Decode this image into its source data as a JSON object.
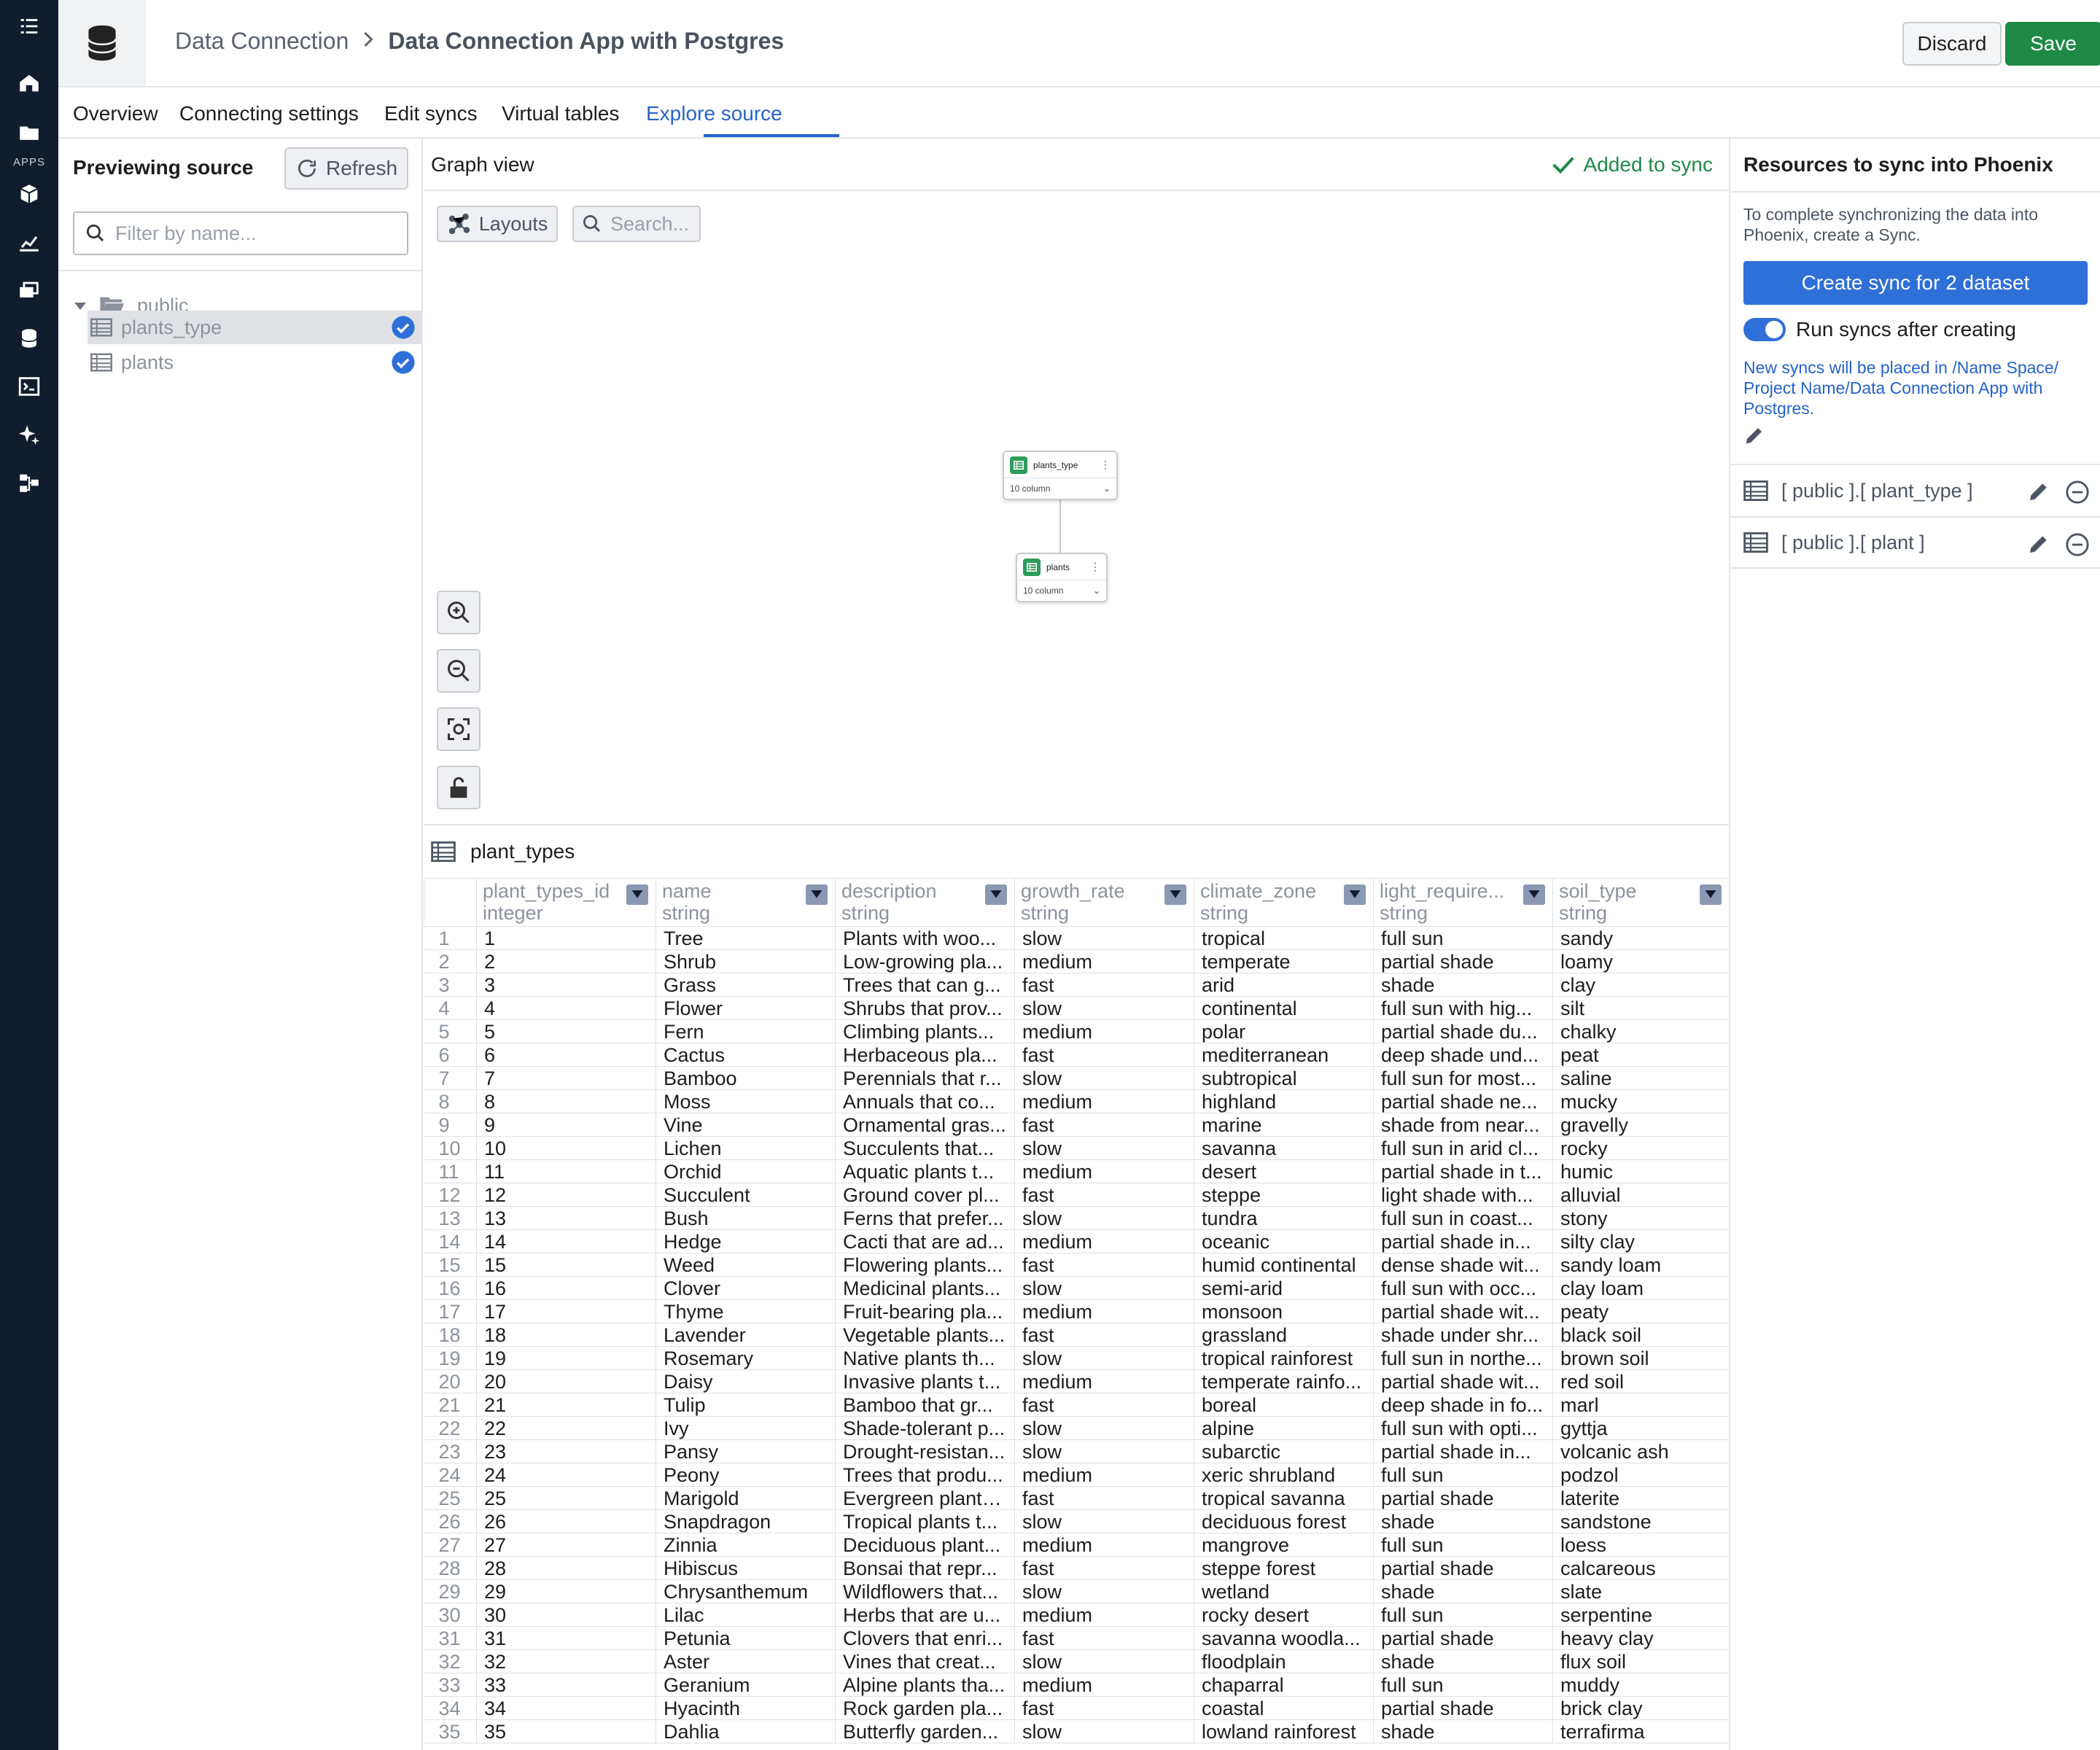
{
  "sidebar": {
    "apps_label": "APPS",
    "icons": [
      "menu-icon",
      "home-icon",
      "folder-icon",
      "cube-icon",
      "chart-icon",
      "layers-icon",
      "database-icon",
      "terminal-icon",
      "sparkle-icon",
      "flow-icon"
    ]
  },
  "header": {
    "breadcrumb_parent": "Data Connection",
    "breadcrumb_current": "Data Connection App with Postgres",
    "discard_label": "Discard",
    "save_label": "Save"
  },
  "tabs": [
    {
      "label": "Overview",
      "active": false
    },
    {
      "label": "Connecting settings",
      "active": false
    },
    {
      "label": "Edit syncs",
      "active": false
    },
    {
      "label": "Virtual tables",
      "active": false
    },
    {
      "label": "Explore source",
      "active": true
    }
  ],
  "left_panel": {
    "title": "Previewing source",
    "refresh_label": "Refresh",
    "filter_placeholder": "Filter by name...",
    "folder": "public",
    "tables": [
      {
        "name": "plants_type",
        "selected": true,
        "checked": true
      },
      {
        "name": "plants",
        "selected": false,
        "checked": true
      }
    ]
  },
  "graph": {
    "title": "Graph view",
    "status": "Added to sync",
    "layouts_label": "Layouts",
    "search_placeholder": "Search...",
    "nodes": [
      {
        "name": "plants_type",
        "columns": "10 column"
      },
      {
        "name": "plants",
        "columns": "10 column"
      }
    ]
  },
  "right_panel": {
    "title": "Resources to sync into  Phoenix",
    "description": "To complete synchronizing the data into Phoenix, create a Sync.",
    "create_label": "Create sync for 2 dataset",
    "toggle_label": "Run syncs after creating",
    "toggle_on": true,
    "note": "New syncs will be placed in /Name Space/ Project Name/Data Connection App with Postgres.",
    "resources": [
      "[ public ].[ plant_type ]",
      "[ public ].[ plant ]"
    ]
  },
  "table": {
    "title": "plant_types",
    "columns": [
      {
        "name": "plant_types_id",
        "type": "integer"
      },
      {
        "name": "name",
        "type": "string"
      },
      {
        "name": "description",
        "type": "string"
      },
      {
        "name": "growth_rate",
        "type": "string"
      },
      {
        "name": "climate_zone",
        "type": "string"
      },
      {
        "name": "light_require...",
        "type": "string"
      },
      {
        "name": "soil_type",
        "type": "string"
      }
    ],
    "rows": [
      [
        "1",
        "1",
        "Tree",
        "Plants with woo...",
        "slow",
        "tropical",
        "full sun",
        "sandy"
      ],
      [
        "2",
        "2",
        "Shrub",
        "Low-growing pla...",
        "medium",
        "temperate",
        "partial shade",
        "loamy"
      ],
      [
        "3",
        "3",
        "Grass",
        "Trees that can g...",
        "fast",
        "arid",
        "shade",
        "clay"
      ],
      [
        "4",
        "4",
        "Flower",
        "Shrubs that prov...",
        "slow",
        "continental",
        "full sun with hig...",
        "silt"
      ],
      [
        "5",
        "5",
        "Fern",
        "Climbing plants...",
        "medium",
        "polar",
        "partial shade du...",
        "chalky"
      ],
      [
        "6",
        "6",
        "Cactus",
        "Herbaceous pla...",
        "fast",
        "mediterranean",
        "deep shade und...",
        "peat"
      ],
      [
        "7",
        "7",
        "Bamboo",
        "Perennials that r...",
        "slow",
        "subtropical",
        "full sun for most...",
        "saline"
      ],
      [
        "8",
        "8",
        "Moss",
        "Annuals that co...",
        "medium",
        "highland",
        "partial shade ne...",
        "mucky"
      ],
      [
        "9",
        "9",
        "Vine",
        "Ornamental gras...",
        "fast",
        "marine",
        "shade from near...",
        "gravelly"
      ],
      [
        "10",
        "10",
        "Lichen",
        "Succulents that...",
        "slow",
        "savanna",
        "full sun in arid cl...",
        "rocky"
      ],
      [
        "11",
        "11",
        "Orchid",
        "Aquatic plants t...",
        "medium",
        "desert",
        "partial shade in t...",
        "humic"
      ],
      [
        "12",
        "12",
        "Succulent",
        "Ground cover pl...",
        "fast",
        "steppe",
        "light shade with...",
        "alluvial"
      ],
      [
        "13",
        "13",
        "Bush",
        "Ferns that prefer...",
        "slow",
        "tundra",
        "full sun in coast...",
        "stony"
      ],
      [
        "14",
        "14",
        "Hedge",
        "Cacti that are ad...",
        "medium",
        "oceanic",
        "partial shade in...",
        "silty clay"
      ],
      [
        "15",
        "15",
        "Weed",
        "Flowering plants...",
        "fast",
        "humid continental",
        "dense shade wit...",
        "sandy loam"
      ],
      [
        "16",
        "16",
        "Clover",
        "Medicinal plants...",
        "slow",
        "semi-arid",
        "full sun with occ...",
        "clay loam"
      ],
      [
        "17",
        "17",
        "Thyme",
        "Fruit-bearing pla...",
        "medium",
        "monsoon",
        "partial shade wit...",
        "peaty"
      ],
      [
        "18",
        "18",
        "Lavender",
        "Vegetable plants...",
        "fast",
        "grassland",
        "shade under shr...",
        "black soil"
      ],
      [
        "19",
        "19",
        "Rosemary",
        "Native plants th...",
        "slow",
        "tropical rainforest",
        "full sun in northe...",
        "brown soil"
      ],
      [
        "20",
        "20",
        "Daisy",
        "Invasive plants t...",
        "medium",
        "temperate rainfo...",
        "partial shade wit...",
        "red soil"
      ],
      [
        "21",
        "21",
        "Tulip",
        "Bamboo that gr...",
        "fast",
        "boreal",
        "deep shade in fo...",
        "marl"
      ],
      [
        "22",
        "22",
        "Ivy",
        "Shade-tolerant p...",
        "slow",
        "alpine",
        "full sun with opti...",
        "gyttja"
      ],
      [
        "23",
        "23",
        "Pansy",
        "Drought-resistan...",
        "slow",
        "subarctic",
        "partial shade in...",
        "volcanic ash"
      ],
      [
        "24",
        "24",
        "Peony",
        "Trees that produ...",
        "medium",
        "xeric shrubland",
        "full sun",
        "podzol"
      ],
      [
        "25",
        "25",
        "Marigold",
        "Evergreen plants...",
        "fast",
        "tropical savanna",
        "partial shade",
        "laterite"
      ],
      [
        "26",
        "26",
        "Snapdragon",
        "Tropical plants t...",
        "slow",
        "deciduous forest",
        "shade",
        "sandstone"
      ],
      [
        "27",
        "27",
        "Zinnia",
        "Deciduous plant...",
        "medium",
        "mangrove",
        "full sun",
        "loess"
      ],
      [
        "28",
        "28",
        "Hibiscus",
        "Bonsai that repr...",
        "fast",
        "steppe forest",
        "partial shade",
        "calcareous"
      ],
      [
        "29",
        "29",
        "Chrysanthemum",
        "Wildflowers that...",
        "slow",
        "wetland",
        "shade",
        "slate"
      ],
      [
        "30",
        "30",
        "Lilac",
        "Herbs that are u...",
        "medium",
        "rocky desert",
        "full sun",
        "serpentine"
      ],
      [
        "31",
        "31",
        "Petunia",
        "Clovers that enri...",
        "fast",
        "savanna woodla...",
        "partial shade",
        "heavy clay"
      ],
      [
        "32",
        "32",
        "Aster",
        "Vines that creat...",
        "slow",
        "floodplain",
        "shade",
        "flux soil"
      ],
      [
        "33",
        "33",
        "Geranium",
        "Alpine plants tha...",
        "medium",
        "chaparral",
        "full sun",
        "muddy"
      ],
      [
        "34",
        "34",
        "Hyacinth",
        "Rock garden pla...",
        "fast",
        "coastal",
        "partial shade",
        "brick clay"
      ],
      [
        "35",
        "35",
        "Dahlia",
        "Butterfly garden...",
        "slow",
        "lowland rainforest",
        "shade",
        "terrafirma"
      ]
    ]
  },
  "colors": {
    "rail": "#111c2e",
    "accent": "#2563c9",
    "save": "#1e8a46",
    "primary_button": "#2f6fd8",
    "node_icon": "#2e9c5a"
  }
}
